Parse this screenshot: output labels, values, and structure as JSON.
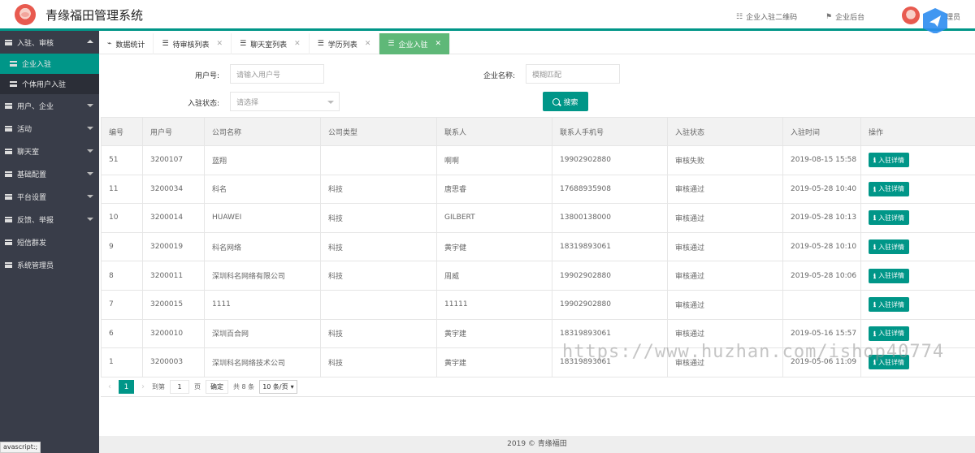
{
  "header": {
    "app_title": "青缘福田管理系统",
    "qr_link": "企业入驻二维码",
    "backend_link": "企业后台",
    "user_name": "理员"
  },
  "sidebar": {
    "items": [
      {
        "label": "入驻、审核",
        "expanded": true
      },
      {
        "label": "企业入驻",
        "sub": true,
        "active": true
      },
      {
        "label": "个体用户入驻",
        "sub": true
      },
      {
        "label": "用户、企业"
      },
      {
        "label": "活动"
      },
      {
        "label": "聊天室"
      },
      {
        "label": "基础配置"
      },
      {
        "label": "平台设置"
      },
      {
        "label": "反馈、举报"
      },
      {
        "label": "短信群发"
      },
      {
        "label": "系统管理员"
      }
    ],
    "status_tip": "avascript:;"
  },
  "tabs": [
    {
      "label": "数据统计",
      "icon": "pulse-icon"
    },
    {
      "label": "待审核列表",
      "icon": "list-icon"
    },
    {
      "label": "聊天室列表",
      "icon": "list-icon"
    },
    {
      "label": "学历列表",
      "icon": "list-icon"
    },
    {
      "label": "企业入驻",
      "icon": "list-icon",
      "active": true
    }
  ],
  "search": {
    "user_no_label": "用户号:",
    "user_no_placeholder": "请输入用户号",
    "company_label": "企业名称:",
    "company_placeholder": "模糊匹配",
    "status_label": "入驻状态:",
    "status_placeholder": "请选择",
    "button": "搜索"
  },
  "table": {
    "columns": [
      "编号",
      "用户号",
      "公司名称",
      "公司类型",
      "联系人",
      "联系人手机号",
      "入驻状态",
      "入驻时间",
      "操作"
    ],
    "action_label": "入驻详情",
    "rows": [
      [
        "51",
        "3200107",
        "蓝翔",
        "",
        "啊啊",
        "19902902880",
        "审核失败",
        "2019-08-15 15:58"
      ],
      [
        "11",
        "3200034",
        "科名",
        "科技",
        "唐思睿",
        "17688935908",
        "审核通过",
        "2019-05-28 10:40"
      ],
      [
        "10",
        "3200014",
        "HUAWEI",
        "科技",
        "GILBERT",
        "13800138000",
        "审核通过",
        "2019-05-28 10:13"
      ],
      [
        "9",
        "3200019",
        "科名网络",
        "科技",
        "黄宇健",
        "18319893061",
        "审核通过",
        "2019-05-28 10:10"
      ],
      [
        "8",
        "3200011",
        "深圳科名网络有限公司",
        "科技",
        "周威",
        "19902902880",
        "审核通过",
        "2019-05-28 10:06"
      ],
      [
        "7",
        "3200015",
        "1111",
        "",
        "11111",
        "19902902880",
        "审核通过",
        ""
      ],
      [
        "6",
        "3200010",
        "深圳百合网",
        "科技",
        "黄宇建",
        "18319893061",
        "审核通过",
        "2019-05-16 15:57"
      ],
      [
        "1",
        "3200003",
        "深圳科名网络技术公司",
        "科技",
        "黄宇建",
        "18319893061",
        "审核通过",
        "2019-05-06 11:09"
      ]
    ]
  },
  "pager": {
    "current": "1",
    "goto_label": "到第",
    "goto_value": "1",
    "page_unit": "页",
    "confirm": "确定",
    "total": "共 8 条",
    "page_size": "10 条/页"
  },
  "footer": "2019 © 青缘福田",
  "watermark": "https://www.huzhan.com/ishop40774",
  "colors": {
    "accent": "#009688",
    "sidebar": "#393d49",
    "active_tab": "#5fb878"
  }
}
